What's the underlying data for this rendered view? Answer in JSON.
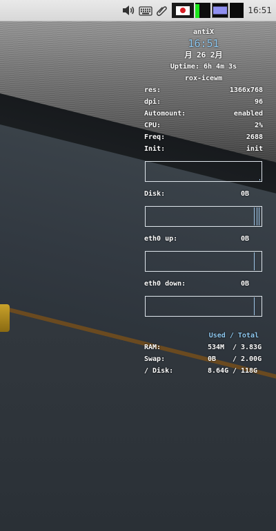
{
  "panel": {
    "clock": "16:51",
    "icons": {
      "volume": "volume-icon",
      "keyboard": "keyboard-icon",
      "clipboard": "paperclip-icon",
      "flag": "japan-flag-icon"
    },
    "memory_level": 0.9
  },
  "conky": {
    "hostname": "antiX",
    "time": "16:51",
    "date": "月 26  2月",
    "uptime": "Uptime: 6h 4m 3s",
    "wm": "rox-icewm",
    "info": [
      {
        "label": "res:",
        "value": "1366x768"
      },
      {
        "label": "dpi:",
        "value": "96"
      },
      {
        "label": "Automount:",
        "value": "enabled"
      },
      {
        "label": "CPU:",
        "value": "2%"
      },
      {
        "label": "Freq:",
        "value": "2688"
      },
      {
        "label": "Init:",
        "value": "init"
      }
    ],
    "graphs": {
      "disk": {
        "label": "Disk:",
        "value": "0B"
      },
      "eth0_up": {
        "label": "eth0 up:",
        "value": "0B"
      },
      "eth0_down": {
        "label": "eth0 down:",
        "value": "0B"
      }
    },
    "stats_header": "Used / Total",
    "stats": [
      {
        "label": "RAM:",
        "used": "534M",
        "sep": "/",
        "total": "3.83G"
      },
      {
        "label": "Swap:",
        "used": "0B",
        "sep": "/",
        "total": "2.00G"
      },
      {
        "label": "/ Disk:",
        "used": "8.64G",
        "sep": "/",
        "total": "118G"
      }
    ]
  },
  "colors": {
    "accent": "#8ec8f0",
    "graph_border": "#dfe6ec"
  }
}
